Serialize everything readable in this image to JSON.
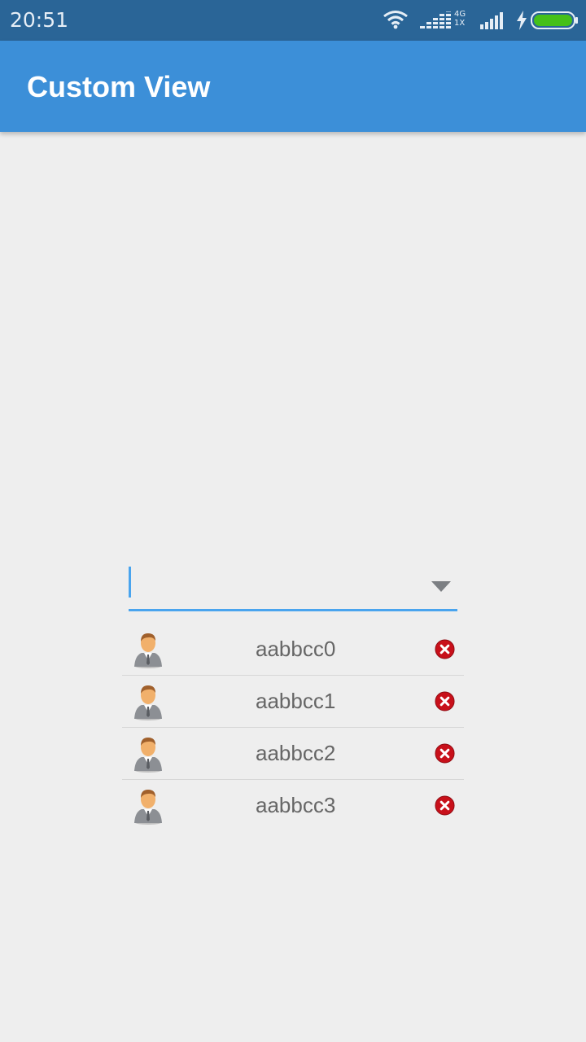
{
  "status_bar": {
    "time": "20:51",
    "network_type": "4G",
    "network_sub": "1X",
    "icons": [
      "wifi-icon",
      "signal-icon",
      "signal-icon",
      "charging-icon",
      "battery-icon"
    ],
    "battery_color": "#45c019"
  },
  "app_bar": {
    "title": "Custom View",
    "color": "#3c8fd8"
  },
  "combo": {
    "value": "",
    "placeholder": "",
    "accent_color": "#49a4ee"
  },
  "list": {
    "items": [
      {
        "label": "aabbcc0"
      },
      {
        "label": "aabbcc1"
      },
      {
        "label": "aabbcc2"
      },
      {
        "label": "aabbcc3"
      }
    ],
    "delete_color": "#c8101a"
  }
}
